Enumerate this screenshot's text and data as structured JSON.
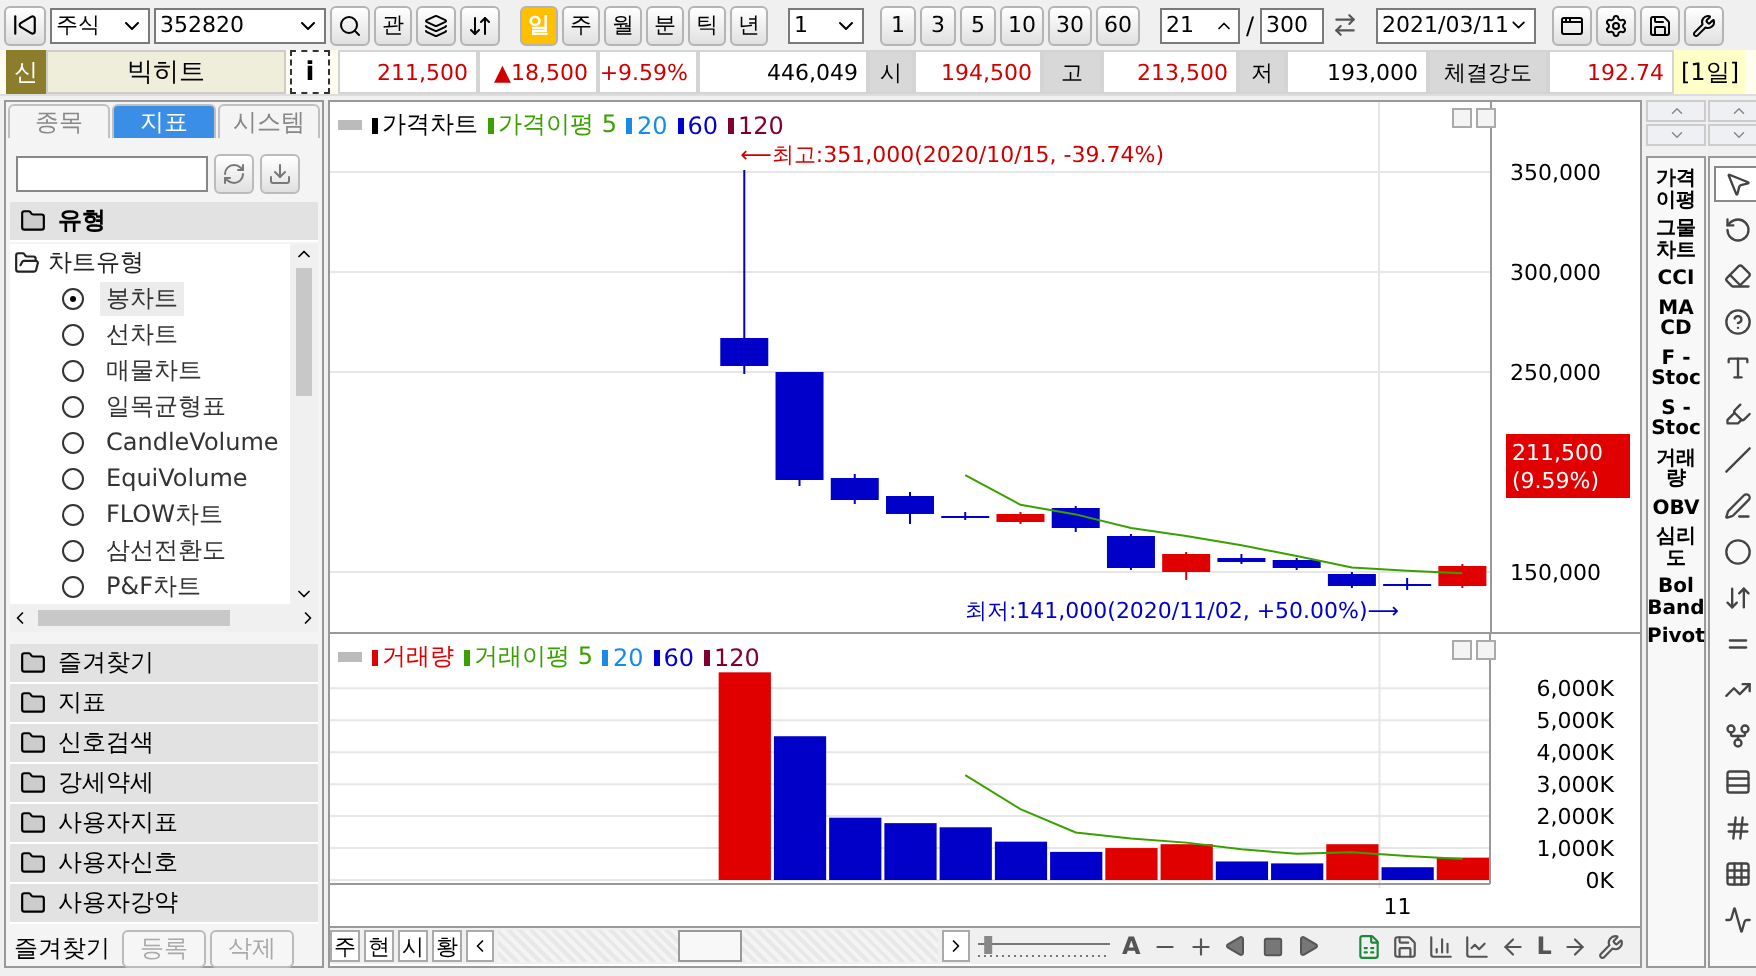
{
  "toolbar": {
    "market": "주식",
    "code": "352820",
    "watch_button": "관",
    "periods": [
      {
        "label": "일",
        "selected": true
      },
      {
        "label": "주",
        "selected": false
      },
      {
        "label": "월",
        "selected": false
      },
      {
        "label": "분",
        "selected": false
      },
      {
        "label": "틱",
        "selected": false
      },
      {
        "label": "년",
        "selected": false
      }
    ],
    "interval": "1",
    "intervals": [
      "1",
      "3",
      "5",
      "10",
      "30",
      "60"
    ],
    "visible_count": "21",
    "separator": "/",
    "total_count": "300",
    "date": "2021/03/11"
  },
  "quote": {
    "badge": "신",
    "name": "빅히트",
    "info_button": "i",
    "cells": [
      {
        "value": "211,500",
        "rising": true
      },
      {
        "value": "▲18,500",
        "rising": true
      },
      {
        "value": "+9.59%",
        "rising": true
      },
      {
        "value": "446,049",
        "rising": false
      }
    ],
    "fields": [
      {
        "label": "시",
        "value": "194,500",
        "rising": true
      },
      {
        "label": "고",
        "value": "213,500",
        "rising": true
      },
      {
        "label": "저",
        "value": "193,000",
        "rising": false
      },
      {
        "label": "체결강도",
        "value": "192.74",
        "rising": true
      }
    ],
    "period_tag": "[1일]"
  },
  "sidebar": {
    "tabs": [
      {
        "label": "종목",
        "selected": false
      },
      {
        "label": "지표",
        "selected": true
      },
      {
        "label": "시스템",
        "selected": false
      }
    ],
    "section": "유형",
    "tree": {
      "label": "차트유형",
      "expanded": true,
      "children": [
        {
          "label": "봉차트",
          "selected": true
        },
        {
          "label": "선차트",
          "selected": false
        },
        {
          "label": "매물차트",
          "selected": false
        },
        {
          "label": "일목균형표",
          "selected": false
        },
        {
          "label": "CandleVolume",
          "selected": false
        },
        {
          "label": "EquiVolume",
          "selected": false
        },
        {
          "label": "FLOW차트",
          "selected": false
        },
        {
          "label": "삼선전환도",
          "selected": false
        },
        {
          "label": "P&F차트",
          "selected": false
        }
      ]
    },
    "folders": [
      "즐겨찾기",
      "지표",
      "신호검색",
      "강세약세",
      "사용자지표",
      "사용자신호",
      "사용자강약"
    ],
    "footer": {
      "label": "즐겨찾기",
      "buttons": [
        {
          "label": "등록",
          "disabled": true
        },
        {
          "label": "삭제",
          "disabled": true
        }
      ]
    }
  },
  "price_panel": {
    "legend": [
      {
        "label": "가격차트",
        "color": "#000000"
      },
      {
        "label": "가격이평 5",
        "color": "#3aa000"
      },
      {
        "label": "20",
        "color": "#1a8ae8"
      },
      {
        "label": "60",
        "color": "#0000d0"
      },
      {
        "label": "120",
        "color": "#800030"
      }
    ],
    "high_note": "⟵최고:351,000(2020/10/15, -39.74%)",
    "low_note": "최저:141,000(2020/11/02, +50.00%)⟶",
    "price_axis": [
      "350,000",
      "300,000",
      "250,000",
      "150,000"
    ],
    "price_tag": "211,500",
    "rate_tag": "(9.59%)"
  },
  "volume_panel": {
    "legend": [
      {
        "label": "20",
        "color": "#1a8ae8"
      },
      {
        "label": "60",
        "color": "#0000d0"
      },
      {
        "label": "120",
        "color": "#800030"
      }
    ],
    "x_label": "11",
    "chart_data": {
      "type": "bar",
      "grid": true,
      "ylim": [
        0,
        7700
      ],
      "yticks": [
        {
          "value": 6000,
          "label": "6,000K"
        },
        {
          "value": 5000,
          "label": "5,000K"
        },
        {
          "value": 4000,
          "label": "4,000K"
        },
        {
          "value": 3000,
          "label": "3,000K"
        },
        {
          "value": 2000,
          "label": "2,000K"
        },
        {
          "value": 1000,
          "label": "1,000K"
        },
        {
          "value": 0,
          "label": "0K"
        }
      ],
      "series": [
        {
          "name": "거래량",
          "color": "#e00000",
          "values": [
            null,
            null,
            null,
            null,
            null,
            null,
            null,
            6500,
            null,
            null,
            null,
            null,
            null,
            null,
            1000,
            1120,
            null,
            null,
            1120,
            null,
            700
          ]
        },
        {
          "color": "#0000c8",
          "values": [
            null,
            null,
            null,
            null,
            null,
            null,
            null,
            null,
            4500,
            1950,
            1780,
            1650,
            1200,
            880,
            null,
            null,
            580,
            520,
            null,
            400,
            null
          ]
        },
        {
          "name": "거래이평 5",
          "type": "line",
          "color": "#3aa000",
          "values": [
            null,
            null,
            null,
            null,
            null,
            null,
            null,
            null,
            null,
            null,
            null,
            3280,
            2220,
            1490,
            1300,
            1170,
            960,
            820,
            870,
            750,
            660
          ]
        }
      ]
    }
  },
  "bottom_bar": {
    "buttons": [
      "주",
      "현",
      "시",
      "황"
    ],
    "zoom_slider": {
      "level": 0.05
    },
    "zoom_label": "A",
    "line_label": "L"
  },
  "indicators": [
    "가격\n이평",
    "그물\n차트",
    "CCI",
    "MA\nCD",
    "F -\nStoc",
    "S -\nStoc",
    "거래\n량",
    "OBV",
    "심리\n도",
    "Bol\nBand",
    "Pivot"
  ]
}
